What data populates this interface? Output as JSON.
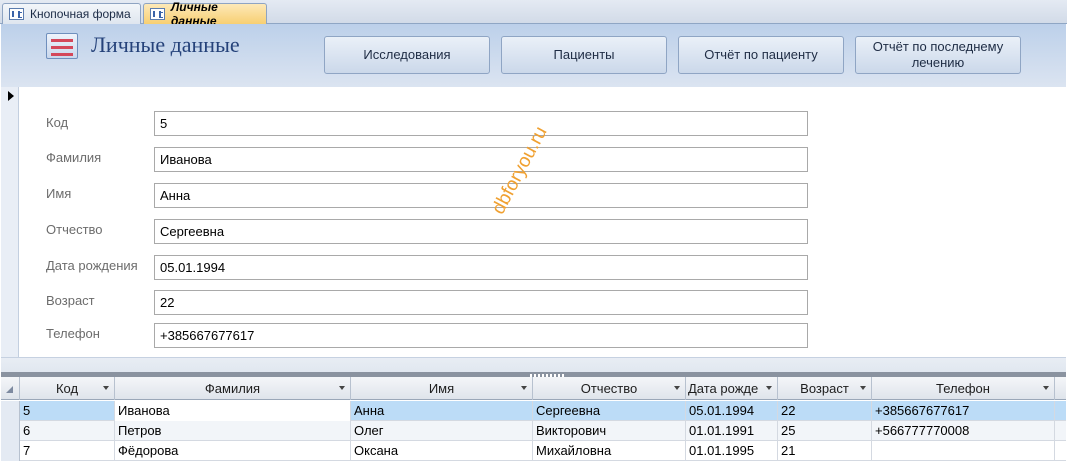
{
  "tabs": [
    {
      "label": "Кнопочная форма",
      "active": false
    },
    {
      "label": "Личные данные",
      "active": true
    }
  ],
  "header": {
    "title": "Личные данные",
    "buttons": [
      "Исследования",
      "Пациенты",
      "Отчёт по пациенту",
      "Отчёт по последнему лечению"
    ]
  },
  "form": {
    "fields": [
      {
        "label": "Код",
        "value": "5"
      },
      {
        "label": "Фамилия",
        "value": "Иванова"
      },
      {
        "label": "Имя",
        "value": "Анна"
      },
      {
        "label": "Отчество",
        "value": "Сергеевна"
      },
      {
        "label": "Дата рождения",
        "value": "05.01.1994"
      },
      {
        "label": "Возраст",
        "value": "22"
      },
      {
        "label": "Телефон",
        "value": "+385667677617"
      }
    ]
  },
  "watermark": "dbforyou.ru",
  "datasheet": {
    "columns": [
      "Код",
      "Фамилия",
      "Имя",
      "Отчество",
      "Дата рожде",
      "Возраст",
      "Телефон"
    ],
    "rows": [
      [
        "5",
        "Иванова",
        "Анна",
        "Сергеевна",
        "05.01.1994",
        "22",
        "+385667677617"
      ],
      [
        "6",
        "Петров",
        "Олег",
        "Викторович",
        "01.01.1991",
        "25",
        "+566777770008"
      ],
      [
        "7",
        "Фёдорова",
        "Оксана",
        "Михайловна",
        "01.01.1995",
        "21",
        ""
      ]
    ],
    "selected_row": 0
  },
  "colors": {
    "accent_tab": "#f7cf72",
    "title": "#25427a",
    "selected_row": "#bcdcf7"
  }
}
